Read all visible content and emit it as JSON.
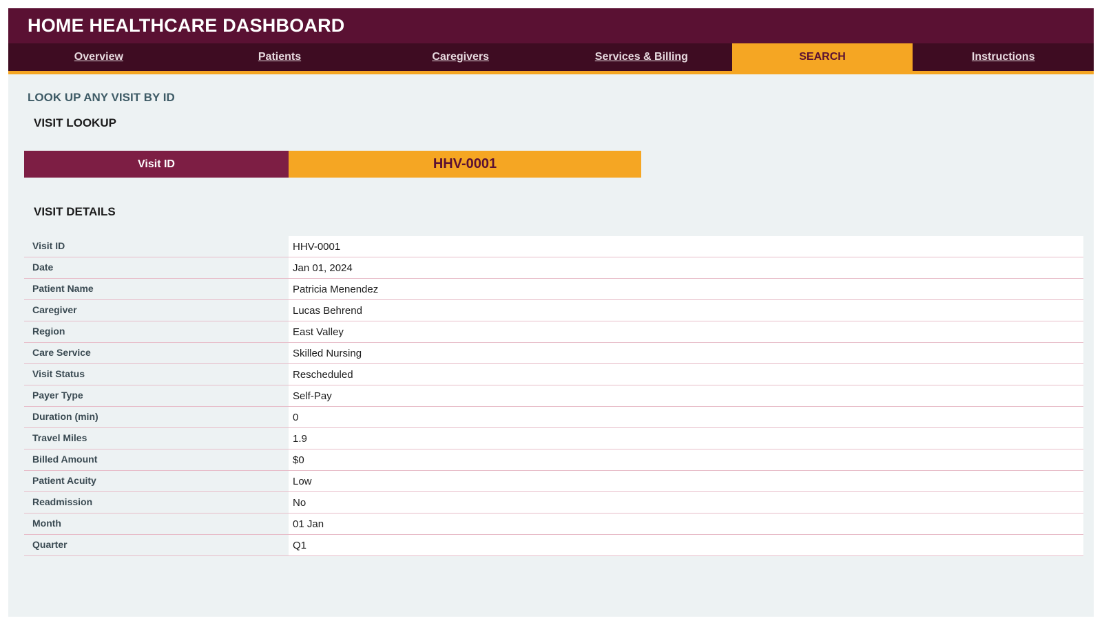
{
  "header": {
    "title": "HOME HEALTHCARE DASHBOARD"
  },
  "tabs": [
    {
      "label": "Overview",
      "active": false
    },
    {
      "label": "Patients",
      "active": false
    },
    {
      "label": "Caregivers",
      "active": false
    },
    {
      "label": "Services & Billing",
      "active": false
    },
    {
      "label": "SEARCH",
      "active": true
    },
    {
      "label": "Instructions",
      "active": false
    }
  ],
  "page": {
    "heading": "LOOK UP ANY VISIT BY ID",
    "lookup_heading": "VISIT LOOKUP",
    "details_heading": "VISIT DETAILS"
  },
  "lookup": {
    "label": "Visit ID",
    "value": "HHV-0001"
  },
  "details": [
    {
      "label": "Visit ID",
      "value": "HHV-0001"
    },
    {
      "label": "Date",
      "value": "Jan 01, 2024"
    },
    {
      "label": "Patient Name",
      "value": "Patricia Menendez"
    },
    {
      "label": "Caregiver",
      "value": "Lucas Behrend"
    },
    {
      "label": "Region",
      "value": "East Valley"
    },
    {
      "label": "Care Service",
      "value": "Skilled Nursing"
    },
    {
      "label": "Visit Status",
      "value": "Rescheduled"
    },
    {
      "label": "Payer Type",
      "value": "Self-Pay"
    },
    {
      "label": "Duration (min)",
      "value": "0"
    },
    {
      "label": "Travel Miles",
      "value": "1.9"
    },
    {
      "label": "Billed Amount",
      "value": "$0"
    },
    {
      "label": "Patient Acuity",
      "value": "Low"
    },
    {
      "label": "Readmission",
      "value": "No"
    },
    {
      "label": "Month",
      "value": "01 Jan"
    },
    {
      "label": "Quarter",
      "value": "Q1"
    }
  ],
  "colors": {
    "header": "#5a1133",
    "tabs": "#3e0c22",
    "accent": "#f5a623",
    "label_fill": "#7d1e44",
    "background": "#edf2f3"
  }
}
